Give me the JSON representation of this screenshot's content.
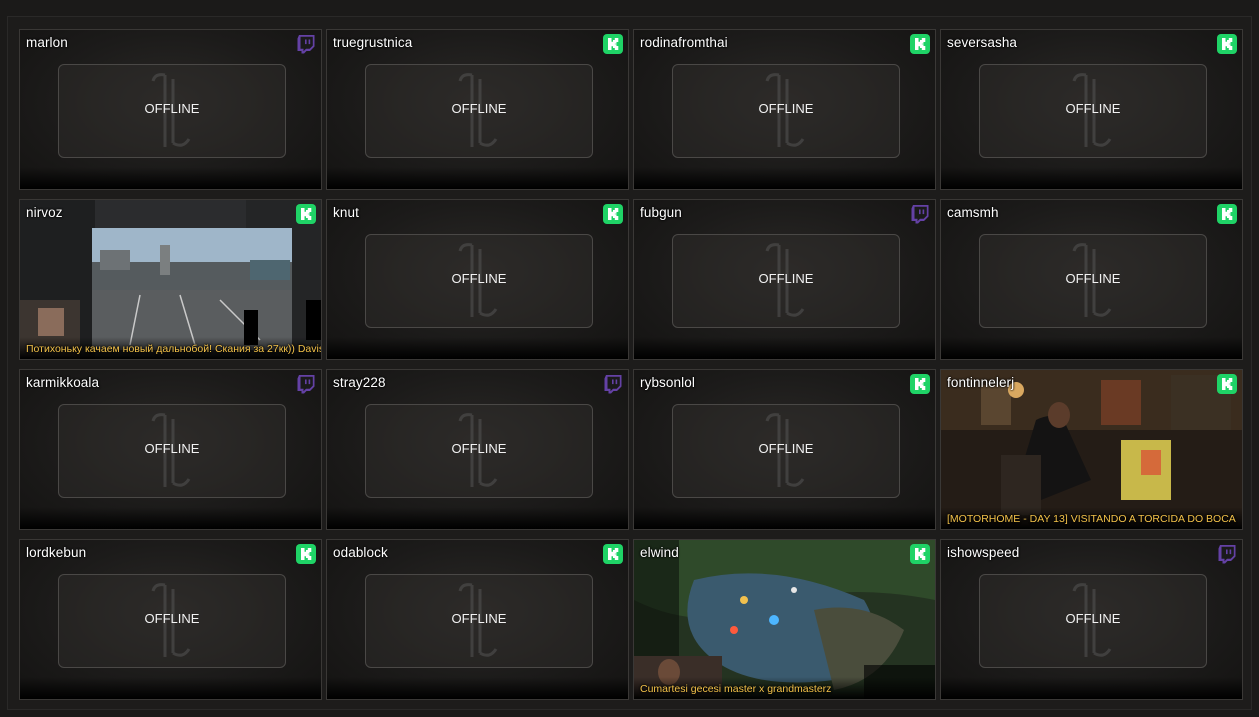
{
  "offline_label": "OFFLINE",
  "colors": {
    "twitch": "#6441a5",
    "kick": "#53fc18",
    "title": "#f3c24a"
  },
  "channels": [
    {
      "name": "marlon",
      "platform": "twitch-icon",
      "status": "offline"
    },
    {
      "name": "truegrustnica",
      "platform": "kick-icon",
      "status": "offline"
    },
    {
      "name": "rodinafromthai",
      "platform": "kick-icon",
      "status": "offline"
    },
    {
      "name": "seversasha",
      "platform": "kick-icon",
      "status": "offline"
    },
    {
      "name": "nirvoz",
      "platform": "kick-icon",
      "status": "live",
      "title": "Потихоньку качаем новый дальнобой! Скания за 27кк)) Davis"
    },
    {
      "name": "knut",
      "platform": "kick-icon",
      "status": "offline"
    },
    {
      "name": "fubgun",
      "platform": "twitch-icon",
      "status": "offline"
    },
    {
      "name": "camsmh",
      "platform": "kick-icon",
      "status": "offline"
    },
    {
      "name": "karmikkoala",
      "platform": "twitch-icon",
      "status": "offline"
    },
    {
      "name": "stray228",
      "platform": "twitch-icon",
      "status": "offline"
    },
    {
      "name": "rybsonlol",
      "platform": "kick-icon",
      "status": "offline"
    },
    {
      "name": "fontinnelerj",
      "platform": "kick-icon",
      "status": "live",
      "title": "[MOTORHOME - DAY 13]  VISITANDO A TORCIDA DO BOCA"
    },
    {
      "name": "lordkebun",
      "platform": "kick-icon",
      "status": "offline"
    },
    {
      "name": "odablock",
      "platform": "kick-icon",
      "status": "offline"
    },
    {
      "name": "elwind",
      "platform": "kick-icon",
      "status": "live",
      "title": "Cumartesi gecesi master x grandmasterz"
    },
    {
      "name": "ishowspeed",
      "platform": "twitch-icon",
      "status": "offline"
    }
  ]
}
